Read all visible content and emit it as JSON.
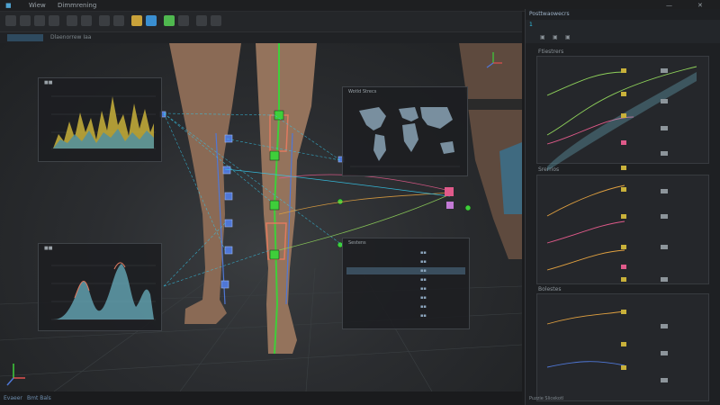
{
  "menubar": {
    "items": [
      "Wiew",
      "Dimmrening"
    ]
  },
  "subbar": {
    "label": "Dlaenorrew Iaa"
  },
  "overlays": {
    "map_title": "Wotld Strecs",
    "list_title": "Sestens"
  },
  "panel": {
    "title": "Posttwaowecrs",
    "tab": "1",
    "sections": [
      "Ftiestrers",
      "Srerrios",
      "Bolestes"
    ]
  },
  "statusbar": {
    "left": "Evaeer",
    "mid": "Bmt Bals",
    "right": "Puzzie Slicekotl"
  },
  "colors": {
    "accent": "#35c5e8",
    "bone": "#3ecf3a",
    "curve_green": "#8ed05a",
    "curve_pink": "#e05a8a",
    "curve_orange": "#e0a040",
    "panel_bg": "#1e2023"
  }
}
